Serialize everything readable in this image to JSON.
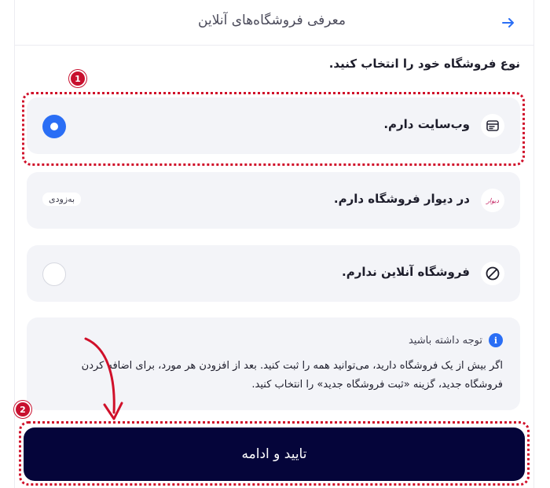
{
  "header": {
    "title": "معرفی فروشگاه‌های آنلاین"
  },
  "prompt": "نوع فروشگاه خود را انتخاب کنید.",
  "options": [
    {
      "label": "وب‌سایت دارم.",
      "selected": true
    },
    {
      "label": "در دیوار فروشگاه دارم.",
      "badge": "به‌زودی",
      "logo_text": "دیوار"
    },
    {
      "label": "فروشگاه آنلاین ندارم.",
      "selected": false
    }
  ],
  "notice": {
    "title": "توجه داشته باشید",
    "body": "اگر بیش از یک فروشگاه دارید، می‌توانید همه را ثبت کنید. بعد از افزودن هر مورد، برای اضافه کردن فروشگاه جدید، گزینه «ثبت فروشگاه جدید» را انتخاب کنید."
  },
  "cta_label": "تایید و ادامه",
  "annotations": {
    "marker_1": "1",
    "marker_2": "2"
  },
  "colors": {
    "accent": "#2a6ef5",
    "cta_bg": "#05053a",
    "highlight": "#d0102a"
  }
}
